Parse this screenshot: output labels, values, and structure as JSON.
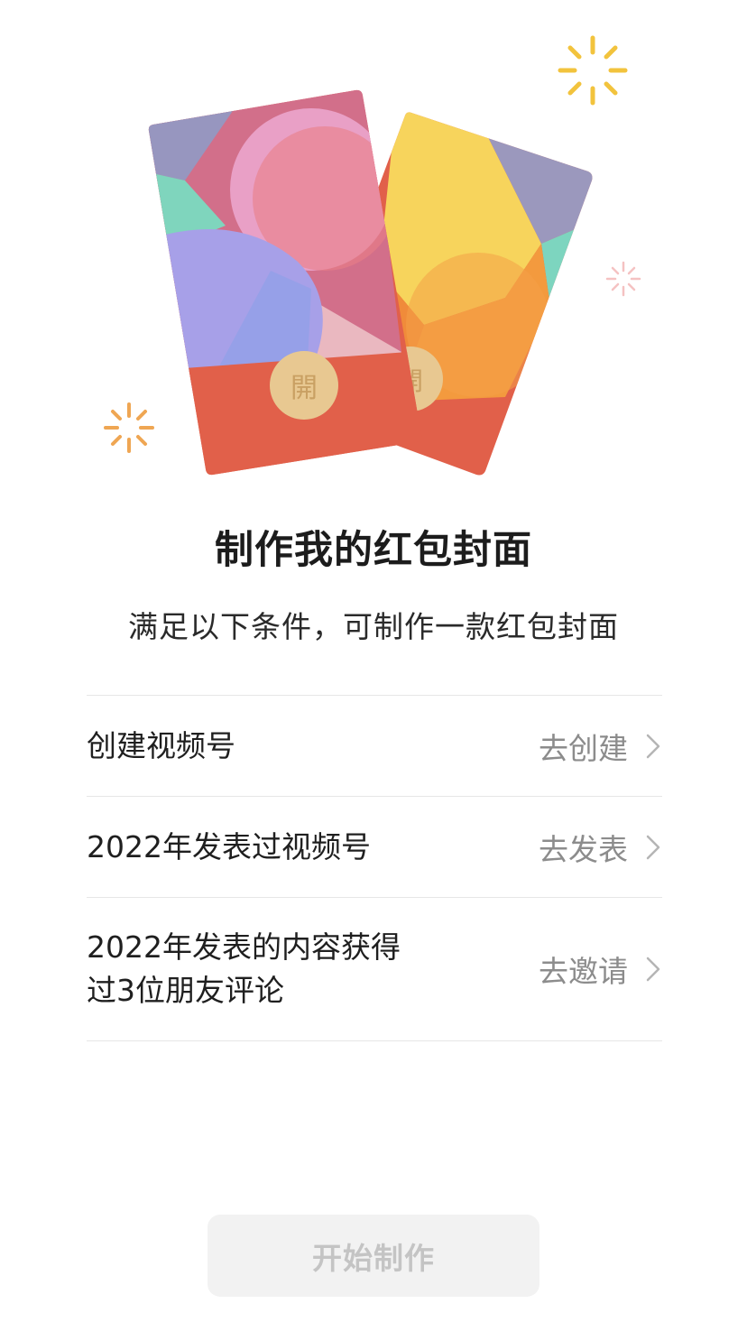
{
  "hero": {
    "left_card_seal": "開",
    "right_card_seal": "開"
  },
  "title": "制作我的红包封面",
  "subtitle": "满足以下条件，可制作一款红包封面",
  "requirements": [
    {
      "label": "创建视频号",
      "action": "去创建"
    },
    {
      "label": "2022年发表过视频号",
      "action": "去发表"
    },
    {
      "label_line1": "2022年发表的内容获得",
      "label_line2": "过3位朋友评论",
      "action": "去邀请"
    }
  ],
  "start_button": "开始制作"
}
